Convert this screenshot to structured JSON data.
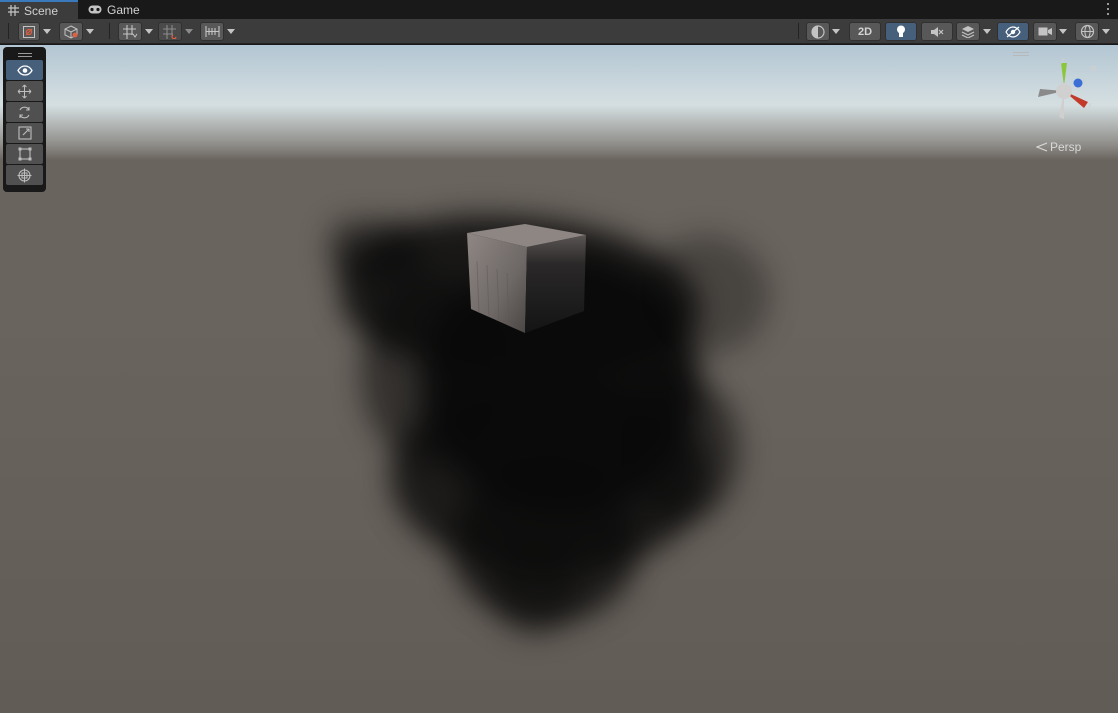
{
  "tabs": [
    {
      "label": "Scene",
      "icon": "grid-icon",
      "active": true
    },
    {
      "label": "Game",
      "icon": "gamepad-icon",
      "active": false
    }
  ],
  "toolbar": {
    "two_d_label": "2D",
    "accent_color": "#46607c"
  },
  "tool_palette": {
    "tools": [
      "view-tool",
      "move-tool",
      "rotate-tool",
      "scale-tool",
      "rect-tool",
      "transform-tool"
    ],
    "active_tool": "view-tool"
  },
  "orientation": {
    "axis_y": "y",
    "axis_z": "z",
    "axis_x": "x",
    "projection_label": "Persp"
  }
}
